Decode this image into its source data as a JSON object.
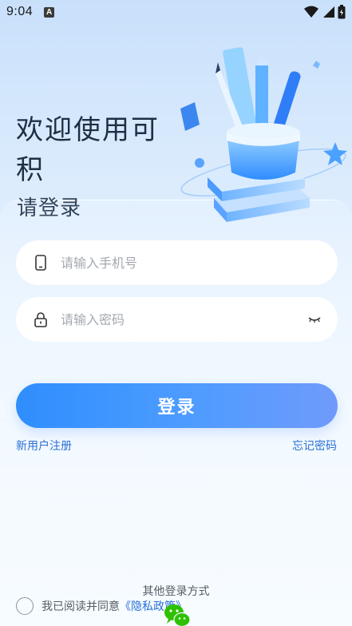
{
  "status_bar": {
    "time": "9:04",
    "badge": "A"
  },
  "header": {
    "welcome": "欢迎使用可积",
    "subtitle": "请登录"
  },
  "form": {
    "phone_placeholder": "请输入手机号",
    "password_placeholder": "请输入密码",
    "login_label": "登录"
  },
  "links": {
    "register": "新用户注册",
    "forgot": "忘记密码"
  },
  "other_login": {
    "label": "其他登录方式",
    "icons": [
      "wechat-icon"
    ]
  },
  "agreement": {
    "text": "我已阅读并同意",
    "policy": "《隐私政策》",
    "checked": false
  },
  "colors": {
    "accent": "#2f8efd",
    "link": "#2b6fd6",
    "wechat": "#2dc100"
  }
}
